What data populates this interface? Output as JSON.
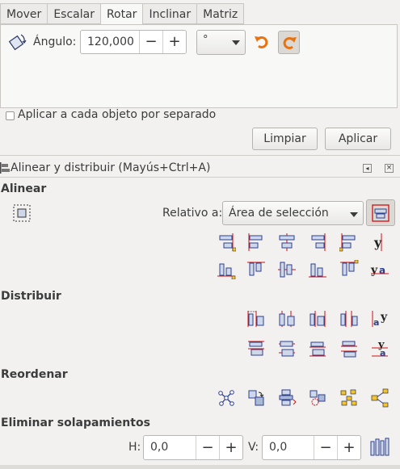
{
  "transform": {
    "tabs": [
      "Mover",
      "Escalar",
      "Rotar",
      "Inclinar",
      "Matriz"
    ],
    "active_tab": "Rotar",
    "angle_label": "Ángulo:",
    "angle_value": "120,000",
    "minus": "−",
    "plus": "+",
    "unit_value": "°",
    "apply_each_label": "Aplicar a cada objeto por separado",
    "clear_button": "Limpiar",
    "apply_button": "Aplicar"
  },
  "align": {
    "panel_title": "Alinear y distribuir (Mayús+Ctrl+A)",
    "align_section": "Alinear",
    "relative_label": "Relativo a:",
    "relative_value": "Área de selección",
    "distribute_section": "Distribuir",
    "reorder_section": "Reordenar",
    "overlap_section": "Eliminar solapamientos",
    "h_label": "H:",
    "h_value": "0,0",
    "v_label": "V:",
    "v_value": "0,0"
  },
  "colors": {
    "accent_orange": "#e8730f",
    "icon_blue": "#2e3f8f",
    "guide_red": "#d01010"
  }
}
